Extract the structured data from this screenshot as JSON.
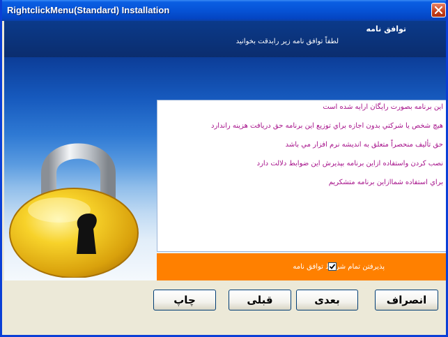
{
  "window": {
    "title": "RightclickMenu(Standard) Installation",
    "close_icon": "close-icon"
  },
  "header": {
    "title": "توافق نامه",
    "subtitle": "لطفاً توافق نامه زير رابدقت بخوانيد"
  },
  "agreement": {
    "lines": [
      "اين برنامه بصورت رايگان ارايه شده است",
      "هيچ شخص يا شركتي بدون اجازه براي توزيع اين برنامه حق دريافت هزينه راندارد",
      "حق تأليف منحصراً متعلق به انديشه نرم افزار مي باشد",
      "نصب كردن واستفاده ازاين برنامه بپذيرش اين ضوابط دلالت دارد",
      "براي استفاده شماازاين برنامه متشكريم"
    ],
    "text_color": "#a6118a"
  },
  "accept": {
    "label": "پذيرفتن تمام شرايط توافق نامه",
    "checked": true,
    "bar_color": "#ff8000"
  },
  "buttons": {
    "cancel": "انصراف",
    "next": "بعدی",
    "back": "قبلی",
    "print": "چاپ"
  },
  "colors": {
    "titlebar": "#0653d6",
    "header": "#0b2d6e",
    "lock": "#f2c21a"
  }
}
